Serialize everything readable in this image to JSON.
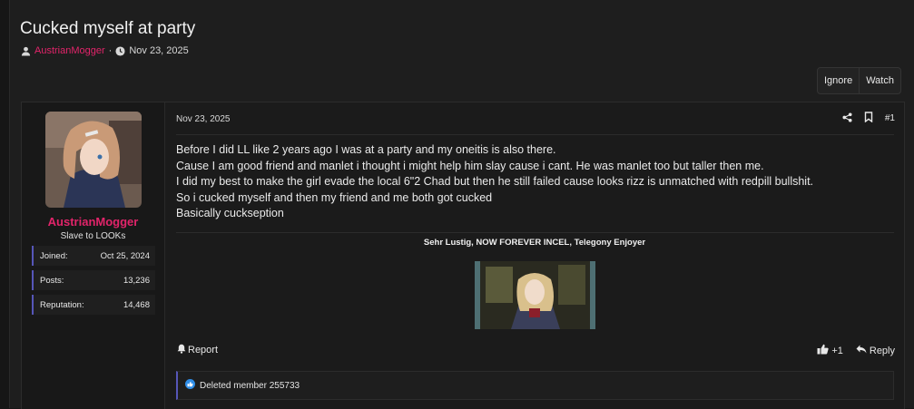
{
  "thread": {
    "title": "Cucked myself at party",
    "author": "AustrianMogger",
    "separator": "·",
    "date": "Nov 23, 2025"
  },
  "actions": {
    "ignore": "Ignore",
    "watch": "Watch"
  },
  "post": {
    "user": {
      "name": "AustrianMogger",
      "title": "Slave to LOOKs",
      "stats": [
        {
          "label": "Joined:",
          "value": "Oct 25, 2024"
        },
        {
          "label": "Posts:",
          "value": "13,236"
        },
        {
          "label": "Reputation:",
          "value": "14,468"
        }
      ]
    },
    "date": "Nov 23, 2025",
    "number": "#1",
    "lines": [
      "Before I did LL like 2 years ago I was at a party and my oneitis is also there.",
      "Cause I am good friend and manlet i thought i might help him slay cause i cant. He was manlet too but taller then me.",
      "I did my best to make the girl evade the local 6\"2 Chad but then he still failed cause looks rizz is unmatched with redpill bullshit.",
      "So i cucked myself and then my friend and me both got cucked",
      "Basically cuckseption"
    ],
    "signature": "Sehr Lustig, NOW FOREVER INCEL, Telegony Enjoyer",
    "footer": {
      "report": "Report",
      "like_count": "+1",
      "reply": "Reply"
    },
    "reactions": {
      "text": "Deleted member 255733"
    }
  },
  "colors": {
    "accent": "#e2246a",
    "stat_border": "#5656b8",
    "like_icon": "#2f8ee8"
  },
  "icons": {
    "author": "user-icon",
    "date": "clock-icon",
    "share": "share-icon",
    "bookmark": "bookmark-icon",
    "report": "bell-icon",
    "like": "thumbs-up-icon",
    "reply": "reply-icon",
    "reaction": "like-reaction-icon"
  }
}
